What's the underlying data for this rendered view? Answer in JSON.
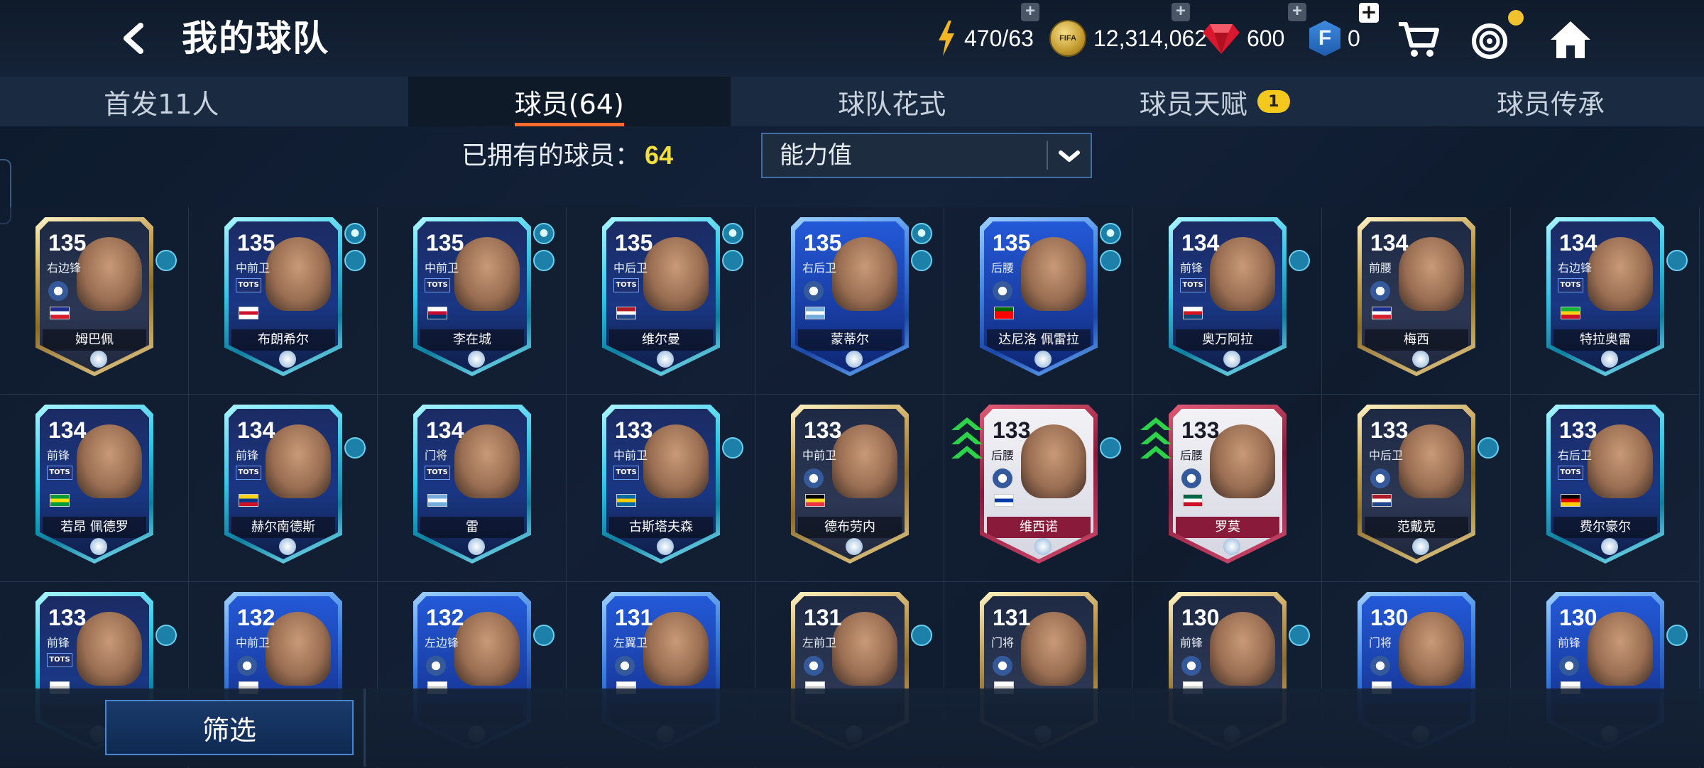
{
  "header": {
    "title": "我的球队",
    "energy": "470/63",
    "coins": "12,314,062",
    "gems": "600",
    "fifa_points": "0",
    "coin_badge": "FIFA"
  },
  "tabs": [
    {
      "label": "首发11人"
    },
    {
      "label": "球员(64)"
    },
    {
      "label": "球队花式"
    },
    {
      "label": "球员天赋",
      "badge": "1"
    },
    {
      "label": "球员传承"
    }
  ],
  "toolbar": {
    "owned_label": "已拥有的球员：",
    "owned_count": "64",
    "sort_value": "能力值"
  },
  "players": [
    {
      "rating": "135",
      "position": "右边锋",
      "name": "姆巴佩",
      "style": "gold",
      "flag_colors": [
        "#1f2f8f",
        "#ffffff",
        "#d81e2c"
      ],
      "club_number": "2"
    },
    {
      "rating": "135",
      "position": "中前卫",
      "name": "布朗希尔",
      "style": "tots",
      "flag_colors": [
        "#ffffff",
        "#d0112b",
        "#ffffff"
      ],
      "locked": true
    },
    {
      "rating": "135",
      "position": "中前卫",
      "name": "李在城",
      "style": "tots",
      "flag_colors": [
        "#ffffff",
        "#c60c30",
        "#003478"
      ],
      "locked": true
    },
    {
      "rating": "135",
      "position": "中后卫",
      "name": "维尔曼",
      "style": "tots",
      "flag_colors": [
        "#ae1c28",
        "#ffffff",
        "#21468b"
      ],
      "locked": true
    },
    {
      "rating": "135",
      "position": "右后卫",
      "name": "蒙蒂尔",
      "style": "ucl",
      "flag_colors": [
        "#74acdf",
        "#ffffff",
        "#74acdf"
      ],
      "locked": true
    },
    {
      "rating": "135",
      "position": "后腰",
      "name": "达尼洛 佩雷拉",
      "style": "ucl",
      "flag_colors": [
        "#006600",
        "#ff0000",
        "#ff0000"
      ],
      "locked": true
    },
    {
      "rating": "134",
      "position": "前锋",
      "name": "奥万阿拉",
      "style": "tots",
      "flag_colors": [
        "#ffffff",
        "#d7141a",
        "#11457e"
      ]
    },
    {
      "rating": "134",
      "position": "前腰",
      "name": "梅西",
      "style": "gold",
      "flag_colors": [
        "#1f2f8f",
        "#ffffff",
        "#d81e2c"
      ],
      "club_number": "2"
    },
    {
      "rating": "134",
      "position": "右边锋",
      "name": "特拉奥雷",
      "style": "tots",
      "flag_colors": [
        "#14b53a",
        "#fcd116",
        "#ce1126"
      ]
    },
    {
      "rating": "134",
      "position": "前锋",
      "name": "若昂 佩德罗",
      "style": "tots",
      "flag_colors": [
        "#009c3b",
        "#ffdf00",
        "#009c3b"
      ]
    },
    {
      "rating": "134",
      "position": "前锋",
      "name": "赫尔南德斯",
      "style": "tots",
      "flag_colors": [
        "#fcd116",
        "#003893",
        "#ce1126"
      ]
    },
    {
      "rating": "134",
      "position": "门将",
      "name": "雷",
      "style": "tots",
      "flag_colors": [
        "#74acdf",
        "#ffffff",
        "#74acdf"
      ]
    },
    {
      "rating": "133",
      "position": "中前卫",
      "name": "古斯塔夫森",
      "style": "tots",
      "flag_colors": [
        "#006aa7",
        "#fecc00",
        "#006aa7"
      ]
    },
    {
      "rating": "133",
      "position": "中前卫",
      "name": "德布劳内",
      "style": "gold",
      "flag_colors": [
        "#000000",
        "#fdda24",
        "#ef3340"
      ]
    },
    {
      "rating": "133",
      "position": "后腰",
      "name": "维西诺",
      "style": "wc",
      "flag_colors": [
        "#ffffff",
        "#0038a8",
        "#ffffff"
      ]
    },
    {
      "rating": "133",
      "position": "后腰",
      "name": "罗莫",
      "style": "wc",
      "flag_colors": [
        "#006847",
        "#ffffff",
        "#ce1126"
      ]
    },
    {
      "rating": "133",
      "position": "中后卫",
      "name": "范戴克",
      "style": "gold",
      "flag_colors": [
        "#ae1c28",
        "#ffffff",
        "#21468b"
      ]
    },
    {
      "rating": "133",
      "position": "右后卫",
      "name": "费尔豪尔",
      "style": "tots",
      "flag_colors": [
        "#000000",
        "#dd0000",
        "#ffce00"
      ]
    },
    {
      "rating": "133",
      "position": "前锋",
      "name": "",
      "style": "tots",
      "flag_colors": [
        "#ffffff",
        "#cccccc",
        "#ffffff"
      ]
    },
    {
      "rating": "132",
      "position": "中前卫",
      "name": "",
      "style": "ucl",
      "flag_colors": [
        "#ffffff",
        "#cccccc",
        "#ffffff"
      ]
    },
    {
      "rating": "132",
      "position": "左边锋",
      "name": "",
      "style": "ucl",
      "flag_colors": [
        "#ffffff",
        "#cccccc",
        "#ffffff"
      ]
    },
    {
      "rating": "131",
      "position": "左翼卫",
      "name": "",
      "style": "ucl",
      "flag_colors": [
        "#ffffff",
        "#cccccc",
        "#ffffff"
      ]
    },
    {
      "rating": "131",
      "position": "左前卫",
      "name": "",
      "style": "gold",
      "flag_colors": [
        "#ffffff",
        "#cccccc",
        "#ffffff"
      ]
    },
    {
      "rating": "131",
      "position": "门将",
      "name": "",
      "style": "gold",
      "flag_colors": [
        "#ffffff",
        "#cccccc",
        "#ffffff"
      ]
    },
    {
      "rating": "130",
      "position": "前锋",
      "name": "",
      "style": "gold",
      "flag_colors": [
        "#ffffff",
        "#cccccc",
        "#ffffff"
      ]
    },
    {
      "rating": "130",
      "position": "门将",
      "name": "",
      "style": "ucl",
      "flag_colors": [
        "#ffffff",
        "#cccccc",
        "#ffffff"
      ]
    },
    {
      "rating": "130",
      "position": "前锋",
      "name": "",
      "style": "ucl",
      "flag_colors": [
        "#ffffff",
        "#cccccc",
        "#ffffff"
      ]
    }
  ],
  "footer": {
    "filter_label": "筛选"
  }
}
